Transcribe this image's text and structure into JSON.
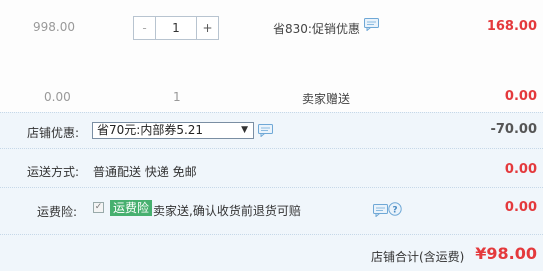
{
  "item": {
    "price": "998.00",
    "quantity": "1",
    "minus_label": "-",
    "plus_label": "+",
    "promo_text": "省830:促销优惠",
    "subtotal": "168.00"
  },
  "gift": {
    "price": "0.00",
    "quantity": "1",
    "desc": "卖家赠送",
    "subtotal": "0.00"
  },
  "coupon": {
    "label": "店铺优惠:",
    "selected": "省70元:内部券5.21",
    "amount": "-70.00"
  },
  "shipping": {
    "label": "运送方式:",
    "value": "普通配送 快递 免邮",
    "amount": "0.00"
  },
  "insurance": {
    "label": "运费险:",
    "tag": "运费险",
    "desc": "卖家送,确认收货前退货可赔",
    "amount": "0.00"
  },
  "total": {
    "label": "店铺合计(含运费)",
    "value": "¥98.00"
  },
  "icons": [
    "message-icon",
    "help-icon",
    "checkbox-checked-icon",
    "dropdown-arrow-icon"
  ],
  "colors": {
    "accent_red": "#e4393c",
    "tag_green": "#47b06f",
    "panel_bg": "#f0f6fb",
    "icon_blue": "#6fa8d6"
  }
}
